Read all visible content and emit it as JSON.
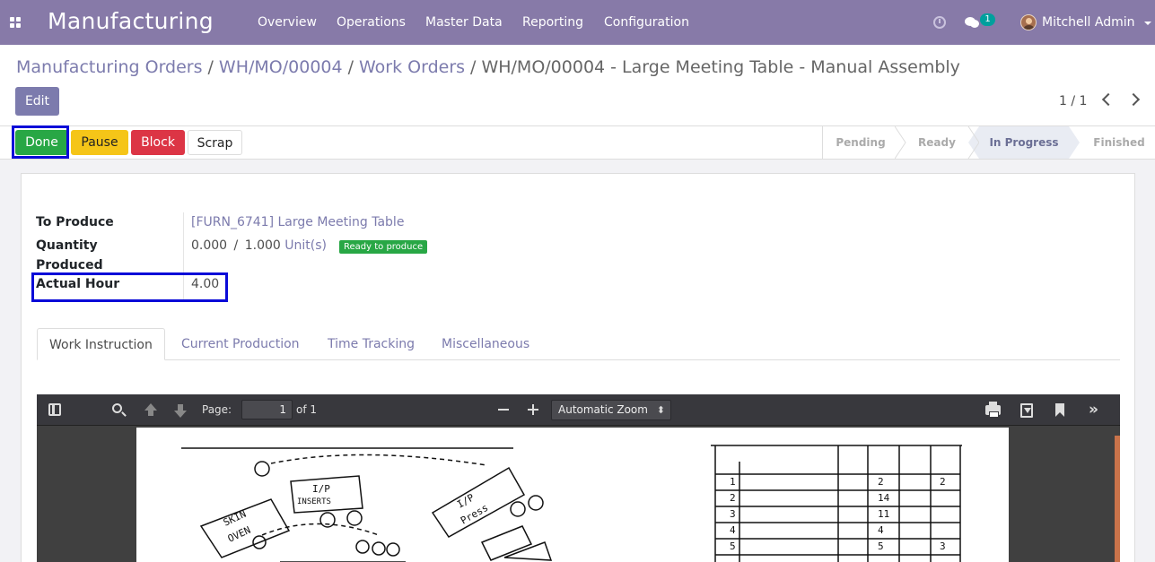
{
  "navbar": {
    "app_name": "Manufacturing",
    "menu": [
      "Overview",
      "Operations",
      "Master Data",
      "Reporting",
      "Configuration"
    ],
    "chat_count": "1",
    "user": "Mitchell Admin",
    "color": "#877aa8"
  },
  "breadcrumb": {
    "items": [
      "Manufacturing Orders",
      "WH/MO/00004",
      "Work Orders"
    ],
    "current": "WH/MO/00004 - Large Meeting Table - Manual Assembly"
  },
  "controls": {
    "edit_label": "Edit",
    "pager": "1 / 1"
  },
  "actions": {
    "done": "Done",
    "pause": "Pause",
    "block": "Block",
    "scrap": "Scrap"
  },
  "stages": [
    "Pending",
    "Ready",
    "In Progress",
    "Finished"
  ],
  "active_stage": "In Progress",
  "form": {
    "to_produce_label": "To Produce",
    "to_produce_value": "[FURN_6741] Large Meeting Table",
    "qty_label_1": "Quantity",
    "qty_label_2": "Produced",
    "qty_done": "0.000",
    "qty_sep": "/",
    "qty_total": "1.000",
    "qty_uom": "Unit(s)",
    "qty_badge": "Ready to produce",
    "hour_label": "Actual Hour",
    "hour_value": "4.00"
  },
  "tabs": [
    "Work Instruction",
    "Current Production",
    "Time Tracking",
    "Miscellaneous"
  ],
  "pdf": {
    "page_label": "Page:",
    "page_value": "1",
    "page_of": "of 1",
    "zoom": "Automatic Zoom"
  }
}
